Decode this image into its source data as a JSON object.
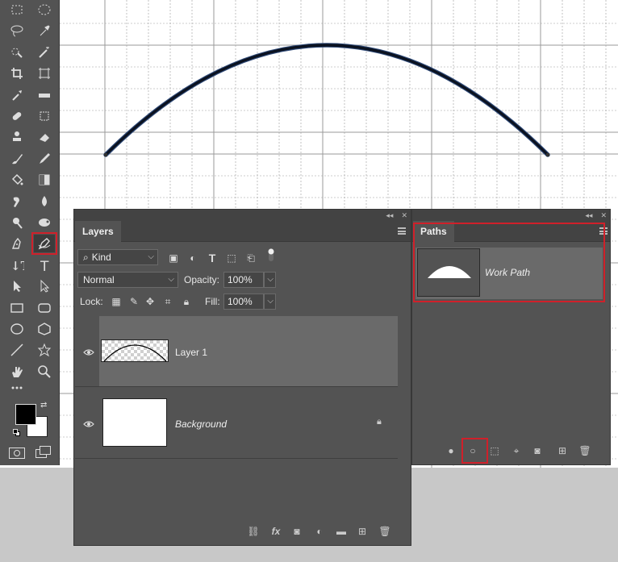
{
  "canvas": {
    "stroke_color": "#0b1220",
    "grid_color": "#9a9a9a"
  },
  "toolbar": {
    "tools": [
      "rect-marquee-icon",
      "ellipse-marquee-icon",
      "lasso-icon",
      "eyedropper-icon",
      "quick-select-icon",
      "magic-wand-icon",
      "crop-icon",
      "frame-icon",
      "color-sampler-icon",
      "ruler-icon",
      "healing-brush-icon",
      "patch-icon",
      "stamp-icon",
      "eraser-icon",
      "brush-icon",
      "pencil-icon",
      "paint-bucket-icon",
      "gradient-icon",
      "smudge-icon",
      "blur-icon",
      "dodge-icon",
      "sponge-icon",
      "pen-icon",
      "curvature-pen-icon",
      "vertical-type-icon",
      "type-icon",
      "path-selection-icon",
      "direct-selection-icon",
      "rectangle-icon",
      "rounded-rectangle-icon",
      "ellipse-icon",
      "polygon-icon",
      "line-icon",
      "custom-shape-icon",
      "hand-icon",
      "zoom-icon",
      "more-tools-icon"
    ],
    "highlight_tool": "curvature-pen-icon",
    "highlight_color": "#d0202a",
    "foreground_color": "#000000",
    "background_color": "#ffffff"
  },
  "layers_panel": {
    "tab_label": "Layers",
    "filter_label": "Kind",
    "blend_mode": "Normal",
    "opacity_label": "Opacity:",
    "opacity_value": "100%",
    "lock_label": "Lock:",
    "fill_label": "Fill:",
    "fill_value": "100%",
    "layers": [
      {
        "name": "Layer 1",
        "selected": true,
        "visible": true
      },
      {
        "name": "Background",
        "selected": false,
        "visible": true,
        "locked": true
      }
    ]
  },
  "paths_panel": {
    "tab_label": "Paths",
    "paths": [
      {
        "name": "Work Path"
      }
    ],
    "highlighted_footer_button": "stroke-path-with-brush-button"
  }
}
